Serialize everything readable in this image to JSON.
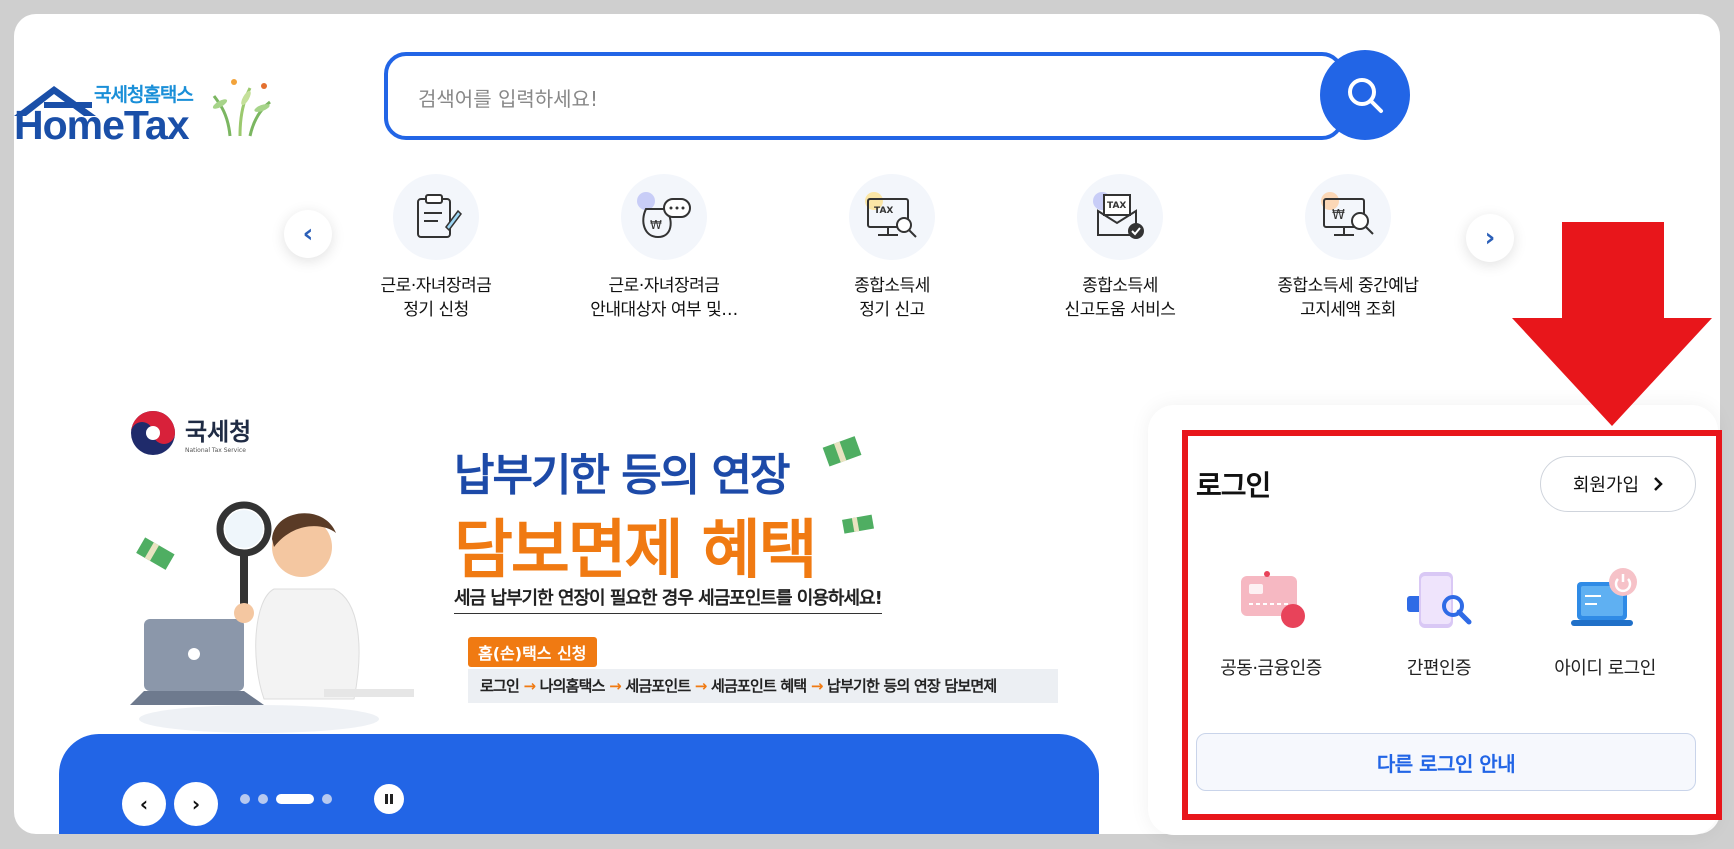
{
  "header": {
    "logo_small": "국세청홈택스",
    "logo_big": "HomeTax",
    "search_placeholder": "검색어를 입력하세요!"
  },
  "quick_menu": {
    "items": [
      {
        "label": "근로·자녀장려금\n정기 신청",
        "icon": "document-edit-icon"
      },
      {
        "label": "근로·자녀장려금\n안내대상자 여부 및…",
        "icon": "money-bag-chat-icon"
      },
      {
        "label": "종합소득세\n정기 신고",
        "icon": "tax-monitor-search-icon"
      },
      {
        "label": "종합소득세\n신고도움 서비스",
        "icon": "tax-envelope-check-icon"
      },
      {
        "label": "종합소득세 중간예납\n고지세액 조회",
        "icon": "monitor-search-icon"
      }
    ]
  },
  "banner": {
    "agency": "국세청",
    "agency_en": "National Tax Service",
    "title1": "납부기한 등의 연장",
    "title2": "담보면제 혜택",
    "subtitle": "세금 납부기한 연장이 필요한 경우 세금포인트를 이용하세요!",
    "tag": "홈(손)택스 신청",
    "steps": [
      "로그인",
      "나의홈택스",
      "세금포인트",
      "세금포인트 혜택",
      "납부기한 등의 연장 담보면제"
    ]
  },
  "login": {
    "title": "로그인",
    "signup": "회원가입",
    "options": [
      {
        "label": "공동·금융인증",
        "icon": "certificate-card-icon"
      },
      {
        "label": "간편인증",
        "icon": "simple-auth-phone-icon"
      },
      {
        "label": "아이디 로그인",
        "icon": "id-login-laptop-icon"
      }
    ],
    "other": "다른 로그인 안내"
  },
  "colors": {
    "primary": "#2265e6",
    "accent_orange": "#f07a12",
    "highlight_red": "#e8161b"
  }
}
